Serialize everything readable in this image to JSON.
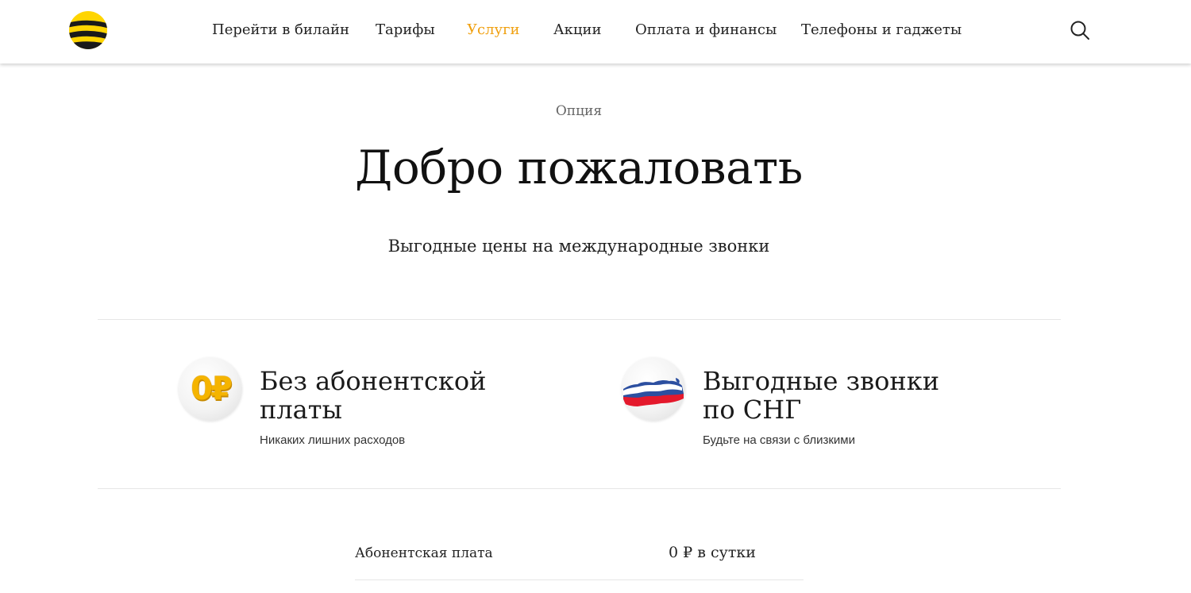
{
  "header": {
    "nav": [
      {
        "label": "Перейти в билайн",
        "active": false
      },
      {
        "label": "Тарифы",
        "active": false
      },
      {
        "label": "Услуги",
        "active": true
      },
      {
        "label": "Акции",
        "active": false
      },
      {
        "label": "Оплата и финансы",
        "active": false
      },
      {
        "label": "Телефоны и гаджеты",
        "active": false
      }
    ],
    "search_icon": "search-icon"
  },
  "hero": {
    "eyebrow": "Опция",
    "title": "Добро пожаловать",
    "subtitle": "Выгодные цены на международные звонки"
  },
  "features": [
    {
      "icon": "zero-ruble-icon",
      "icon_text": "0₽",
      "title": "Без абонентской платы",
      "description": "Никаких лишних расходов"
    },
    {
      "icon": "russia-map-icon",
      "title": "Выгодные звонки по СНГ",
      "description": "Будьте на связи с близкими"
    }
  ],
  "pricing": [
    {
      "label": "Абонентская плата",
      "value": "0 ₽ в сутки"
    }
  ],
  "colors": {
    "brand_yellow": "#FFD500",
    "active_nav": "#F0A010",
    "text": "#1F1F1F"
  }
}
